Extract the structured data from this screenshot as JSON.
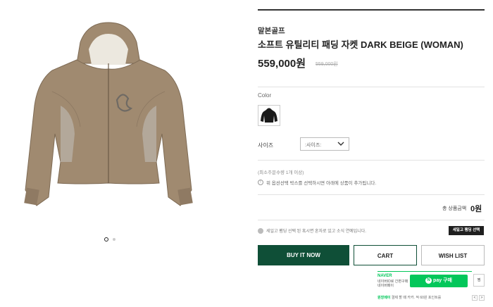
{
  "product": {
    "brand": "말본골프",
    "title": "소프트 유틸리티 패딩 자켓 DARK BEIGE (WOMAN)",
    "price": "559,000원",
    "original_price": "559,000원"
  },
  "gallery": {
    "image_icon": "jacket-image",
    "pagination": [
      {
        "active": true
      },
      {
        "active": false
      }
    ]
  },
  "options": {
    "color_label": "Color",
    "color_swatch_icon": "jacket-thumbnail",
    "size_label": "사이즈",
    "size_placeholder": ":사이즈:",
    "min_qty_note": "(최소주문수량 1개 이상)",
    "select_notice": "위 옵션선택 박스를 선택하시면 아래에 상품이 추가됩니다."
  },
  "total": {
    "label": "총 상품금액",
    "value": "0원"
  },
  "payment_note": "세일고 팸딩 선택 된 혹시면 혼자로 있고 소식 연예입니다.",
  "dark_badge": "세일고 팸딩 선택",
  "buttons": {
    "buy": "BUY IT NOW",
    "cart": "CART",
    "wishlist": "WISH LIST"
  },
  "naver_pay": {
    "brand": "NAVER",
    "description": "네이버ID로 간편구매 네이버페이",
    "button_label": "pay 구매",
    "side_label": "찜",
    "bottom_text_strong": "원장메이",
    "bottom_text": "결제 할 때 카카. 적 60원 포인트를",
    "prev_arrow": "<",
    "next_arrow": ">"
  },
  "colors": {
    "accent_green": "#0f4f37",
    "naver_green": "#03c75a",
    "jacket": "#a08a70"
  }
}
